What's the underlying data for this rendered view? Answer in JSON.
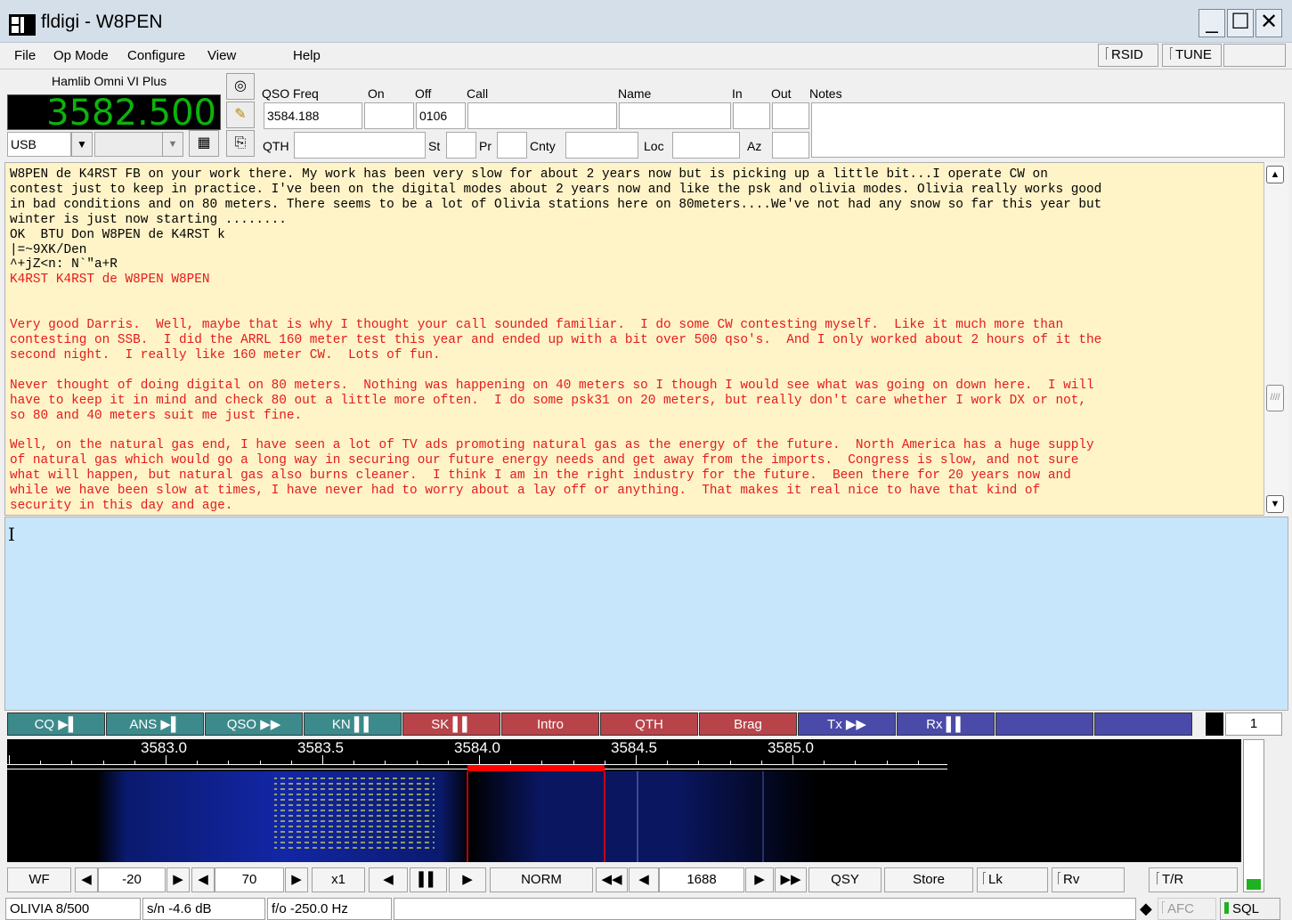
{
  "window": {
    "title": "fldigi - W8PEN"
  },
  "menu": {
    "file": "File",
    "op_mode": "Op Mode",
    "configure": "Configure",
    "view": "View",
    "help": "Help",
    "rsid": "RSID",
    "tune": "TUNE"
  },
  "rig": {
    "name": "Hamlib Omni VI Plus",
    "frequency": "3582.500",
    "mode": "USB"
  },
  "log": {
    "qso_freq_label": "QSO Freq",
    "qso_freq": "3584.188",
    "on_label": "On",
    "on": "",
    "off_label": "Off",
    "off": "0106",
    "call_label": "Call",
    "call": "",
    "name_label": "Name",
    "name": "",
    "in_label": "In",
    "out_label": "Out",
    "notes_label": "Notes",
    "qth_label": "QTH",
    "st_label": "St",
    "pr_label": "Pr",
    "cnty_label": "Cnty",
    "loc_label": "Loc",
    "az_label": "Az"
  },
  "rx_lines": [
    {
      "color": "black",
      "text": "W8PEN de K4RST FB on your work there. My work has been very slow for about 2 years now but is picking up a little bit...I operate CW on"
    },
    {
      "color": "black",
      "text": "contest just to keep in practice. I've been on the digital modes about 2 years now and like the psk and olivia modes. Olivia really works good"
    },
    {
      "color": "black",
      "text": "in bad conditions and on 80 meters. There seems to be a lot of Olivia stations here on 80meters....We've not had any snow so far this year but"
    },
    {
      "color": "black",
      "text": "winter is just now starting ........"
    },
    {
      "color": "black",
      "text": "OK  BTU Don W8PEN de K4RST k"
    },
    {
      "color": "black",
      "text": "|=~9XK/Den"
    },
    {
      "color": "black",
      "text": "^+jZ<n: N`\"a+R"
    },
    {
      "color": "red",
      "text": "K4RST K4RST de W8PEN W8PEN"
    },
    {
      "color": "red",
      "text": ""
    },
    {
      "color": "red",
      "text": ""
    },
    {
      "color": "red",
      "text": "Very good Darris.  Well, maybe that is why I thought your call sounded familiar.  I do some CW contesting myself.  Like it much more than"
    },
    {
      "color": "red",
      "text": "contesting on SSB.  I did the ARRL 160 meter test this year and ended up with a bit over 500 qso's.  And I only worked about 2 hours of it the"
    },
    {
      "color": "red",
      "text": "second night.  I really like 160 meter CW.  Lots of fun."
    },
    {
      "color": "red",
      "text": ""
    },
    {
      "color": "red",
      "text": "Never thought of doing digital on 80 meters.  Nothing was happening on 40 meters so I though I would see what was going on down here.  I will"
    },
    {
      "color": "red",
      "text": "have to keep it in mind and check 80 out a little more often.  I do some psk31 on 20 meters, but really don't care whether I work DX or not,"
    },
    {
      "color": "red",
      "text": "so 80 and 40 meters suit me just fine."
    },
    {
      "color": "red",
      "text": ""
    },
    {
      "color": "red",
      "text": "Well, on the natural gas end, I have seen a lot of TV ads promoting natural gas as the energy of the future.  North America has a huge supply"
    },
    {
      "color": "red",
      "text": "of natural gas which would go a long way in securing our future energy needs and get away from the imports.  Congress is slow, and not sure"
    },
    {
      "color": "red",
      "text": "what will happen, but natural gas also burns cleaner.  I think I am in the right industry for the future.  Been there for 20 years now and"
    },
    {
      "color": "red",
      "text": "while we have been slow at times, I have never had to worry about a lay off or anything.  That makes it real nice to have that kind of"
    },
    {
      "color": "red",
      "text": "security in this day and age."
    }
  ],
  "macros": [
    {
      "label": "CQ ▶▌",
      "color": "#3d8a8c"
    },
    {
      "label": "ANS ▶▌",
      "color": "#3d8a8c"
    },
    {
      "label": "QSO ▶▶",
      "color": "#3d8a8c"
    },
    {
      "label": "KN ▌▌",
      "color": "#3d8a8c"
    },
    {
      "label": "SK ▌▌",
      "color": "#b8444a"
    },
    {
      "label": "Intro",
      "color": "#b8444a"
    },
    {
      "label": "QTH",
      "color": "#b8444a"
    },
    {
      "label": "Brag",
      "color": "#b8444a"
    },
    {
      "label": "Tx ▶▶",
      "color": "#4a4aa8"
    },
    {
      "label": "Rx ▌▌",
      "color": "#4a4aa8"
    },
    {
      "label": "",
      "color": "#4a4aa8"
    },
    {
      "label": "",
      "color": "#4a4aa8"
    }
  ],
  "macro_set": "1",
  "scale_labels": [
    "3583.0",
    "3583.5",
    "3584.0",
    "3584.5",
    "3585.0"
  ],
  "controls": {
    "wf": "WF",
    "ref_level": "-20",
    "range": "70",
    "zoom": "x1",
    "norm": "NORM",
    "carrier": "1688",
    "qsy": "QSY",
    "store": "Store",
    "lk": "Lk",
    "rv": "Rv",
    "tr": "T/R"
  },
  "status": {
    "mode": "OLIVIA 8/500",
    "snr": "s/n -4.6 dB",
    "fo": "f/o -250.0 Hz",
    "afc": "AFC",
    "sql": "SQL"
  },
  "colors": {
    "freq_digits": "#0cb30c",
    "rx_bg": "#fff3c8",
    "tx_bg": "#c7e6fb",
    "rx_red": "#e41b1b",
    "cursor_red": "#ff0000"
  }
}
